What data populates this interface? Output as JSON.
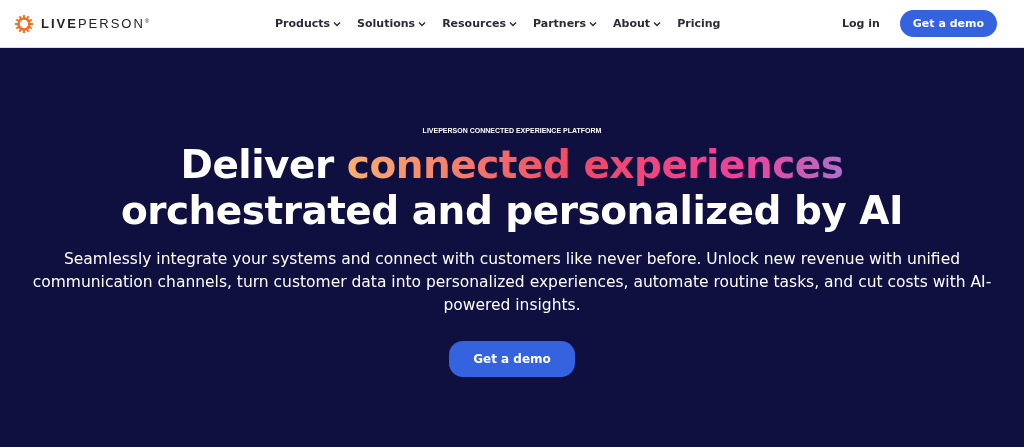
{
  "header": {
    "logo": "**LIVE**PERSON$^{®}$",
    "nav": [
      {
        "label": "Products",
        "dropdown": true
      },
      {
        "label": "Solutions",
        "dropdown": true
      },
      {
        "label": "Resources",
        "dropdown": true
      },
      {
        "label": "Partners",
        "dropdown": true
      },
      {
        "label": "About",
        "dropdown": true
      },
      {
        "label": "Pricing",
        "dropdown": false
      }
    ],
    "login": "Log in",
    "cta": "Get a demo"
  },
  "hero": {
    "eyebrow": "LIVEPERSON CONNECTED EXPERIENCE PLATFORM",
    "headline": {
      "lead": "Deliver",
      "highlight": "connected experiences",
      "rest": "orchestrated and personalized by AI"
    },
    "description": "Seamlessly integrate your systems and connect with customers like never before. Unlock new revenue with unified communication channels, turn customer data into personalized experiences, automate routine tasks, and cut costs with AI-powered insights.",
    "cta": "Get a demo"
  }
}
